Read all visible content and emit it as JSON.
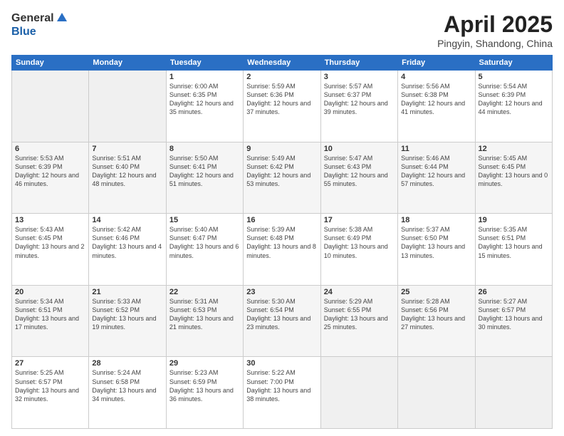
{
  "logo": {
    "general": "General",
    "blue": "Blue"
  },
  "title": {
    "month_year": "April 2025",
    "location": "Pingyin, Shandong, China"
  },
  "weekdays": [
    "Sunday",
    "Monday",
    "Tuesday",
    "Wednesday",
    "Thursday",
    "Friday",
    "Saturday"
  ],
  "weeks": [
    [
      {
        "day": "",
        "sunrise": "",
        "sunset": "",
        "daylight": "",
        "empty": true
      },
      {
        "day": "",
        "sunrise": "",
        "sunset": "",
        "daylight": "",
        "empty": true
      },
      {
        "day": "1",
        "sunrise": "Sunrise: 6:00 AM",
        "sunset": "Sunset: 6:35 PM",
        "daylight": "Daylight: 12 hours and 35 minutes.",
        "empty": false
      },
      {
        "day": "2",
        "sunrise": "Sunrise: 5:59 AM",
        "sunset": "Sunset: 6:36 PM",
        "daylight": "Daylight: 12 hours and 37 minutes.",
        "empty": false
      },
      {
        "day": "3",
        "sunrise": "Sunrise: 5:57 AM",
        "sunset": "Sunset: 6:37 PM",
        "daylight": "Daylight: 12 hours and 39 minutes.",
        "empty": false
      },
      {
        "day": "4",
        "sunrise": "Sunrise: 5:56 AM",
        "sunset": "Sunset: 6:38 PM",
        "daylight": "Daylight: 12 hours and 41 minutes.",
        "empty": false
      },
      {
        "day": "5",
        "sunrise": "Sunrise: 5:54 AM",
        "sunset": "Sunset: 6:39 PM",
        "daylight": "Daylight: 12 hours and 44 minutes.",
        "empty": false
      }
    ],
    [
      {
        "day": "6",
        "sunrise": "Sunrise: 5:53 AM",
        "sunset": "Sunset: 6:39 PM",
        "daylight": "Daylight: 12 hours and 46 minutes.",
        "empty": false
      },
      {
        "day": "7",
        "sunrise": "Sunrise: 5:51 AM",
        "sunset": "Sunset: 6:40 PM",
        "daylight": "Daylight: 12 hours and 48 minutes.",
        "empty": false
      },
      {
        "day": "8",
        "sunrise": "Sunrise: 5:50 AM",
        "sunset": "Sunset: 6:41 PM",
        "daylight": "Daylight: 12 hours and 51 minutes.",
        "empty": false
      },
      {
        "day": "9",
        "sunrise": "Sunrise: 5:49 AM",
        "sunset": "Sunset: 6:42 PM",
        "daylight": "Daylight: 12 hours and 53 minutes.",
        "empty": false
      },
      {
        "day": "10",
        "sunrise": "Sunrise: 5:47 AM",
        "sunset": "Sunset: 6:43 PM",
        "daylight": "Daylight: 12 hours and 55 minutes.",
        "empty": false
      },
      {
        "day": "11",
        "sunrise": "Sunrise: 5:46 AM",
        "sunset": "Sunset: 6:44 PM",
        "daylight": "Daylight: 12 hours and 57 minutes.",
        "empty": false
      },
      {
        "day": "12",
        "sunrise": "Sunrise: 5:45 AM",
        "sunset": "Sunset: 6:45 PM",
        "daylight": "Daylight: 13 hours and 0 minutes.",
        "empty": false
      }
    ],
    [
      {
        "day": "13",
        "sunrise": "Sunrise: 5:43 AM",
        "sunset": "Sunset: 6:45 PM",
        "daylight": "Daylight: 13 hours and 2 minutes.",
        "empty": false
      },
      {
        "day": "14",
        "sunrise": "Sunrise: 5:42 AM",
        "sunset": "Sunset: 6:46 PM",
        "daylight": "Daylight: 13 hours and 4 minutes.",
        "empty": false
      },
      {
        "day": "15",
        "sunrise": "Sunrise: 5:40 AM",
        "sunset": "Sunset: 6:47 PM",
        "daylight": "Daylight: 13 hours and 6 minutes.",
        "empty": false
      },
      {
        "day": "16",
        "sunrise": "Sunrise: 5:39 AM",
        "sunset": "Sunset: 6:48 PM",
        "daylight": "Daylight: 13 hours and 8 minutes.",
        "empty": false
      },
      {
        "day": "17",
        "sunrise": "Sunrise: 5:38 AM",
        "sunset": "Sunset: 6:49 PM",
        "daylight": "Daylight: 13 hours and 10 minutes.",
        "empty": false
      },
      {
        "day": "18",
        "sunrise": "Sunrise: 5:37 AM",
        "sunset": "Sunset: 6:50 PM",
        "daylight": "Daylight: 13 hours and 13 minutes.",
        "empty": false
      },
      {
        "day": "19",
        "sunrise": "Sunrise: 5:35 AM",
        "sunset": "Sunset: 6:51 PM",
        "daylight": "Daylight: 13 hours and 15 minutes.",
        "empty": false
      }
    ],
    [
      {
        "day": "20",
        "sunrise": "Sunrise: 5:34 AM",
        "sunset": "Sunset: 6:51 PM",
        "daylight": "Daylight: 13 hours and 17 minutes.",
        "empty": false
      },
      {
        "day": "21",
        "sunrise": "Sunrise: 5:33 AM",
        "sunset": "Sunset: 6:52 PM",
        "daylight": "Daylight: 13 hours and 19 minutes.",
        "empty": false
      },
      {
        "day": "22",
        "sunrise": "Sunrise: 5:31 AM",
        "sunset": "Sunset: 6:53 PM",
        "daylight": "Daylight: 13 hours and 21 minutes.",
        "empty": false
      },
      {
        "day": "23",
        "sunrise": "Sunrise: 5:30 AM",
        "sunset": "Sunset: 6:54 PM",
        "daylight": "Daylight: 13 hours and 23 minutes.",
        "empty": false
      },
      {
        "day": "24",
        "sunrise": "Sunrise: 5:29 AM",
        "sunset": "Sunset: 6:55 PM",
        "daylight": "Daylight: 13 hours and 25 minutes.",
        "empty": false
      },
      {
        "day": "25",
        "sunrise": "Sunrise: 5:28 AM",
        "sunset": "Sunset: 6:56 PM",
        "daylight": "Daylight: 13 hours and 27 minutes.",
        "empty": false
      },
      {
        "day": "26",
        "sunrise": "Sunrise: 5:27 AM",
        "sunset": "Sunset: 6:57 PM",
        "daylight": "Daylight: 13 hours and 30 minutes.",
        "empty": false
      }
    ],
    [
      {
        "day": "27",
        "sunrise": "Sunrise: 5:25 AM",
        "sunset": "Sunset: 6:57 PM",
        "daylight": "Daylight: 13 hours and 32 minutes.",
        "empty": false
      },
      {
        "day": "28",
        "sunrise": "Sunrise: 5:24 AM",
        "sunset": "Sunset: 6:58 PM",
        "daylight": "Daylight: 13 hours and 34 minutes.",
        "empty": false
      },
      {
        "day": "29",
        "sunrise": "Sunrise: 5:23 AM",
        "sunset": "Sunset: 6:59 PM",
        "daylight": "Daylight: 13 hours and 36 minutes.",
        "empty": false
      },
      {
        "day": "30",
        "sunrise": "Sunrise: 5:22 AM",
        "sunset": "Sunset: 7:00 PM",
        "daylight": "Daylight: 13 hours and 38 minutes.",
        "empty": false
      },
      {
        "day": "",
        "sunrise": "",
        "sunset": "",
        "daylight": "",
        "empty": true
      },
      {
        "day": "",
        "sunrise": "",
        "sunset": "",
        "daylight": "",
        "empty": true
      },
      {
        "day": "",
        "sunrise": "",
        "sunset": "",
        "daylight": "",
        "empty": true
      }
    ]
  ]
}
